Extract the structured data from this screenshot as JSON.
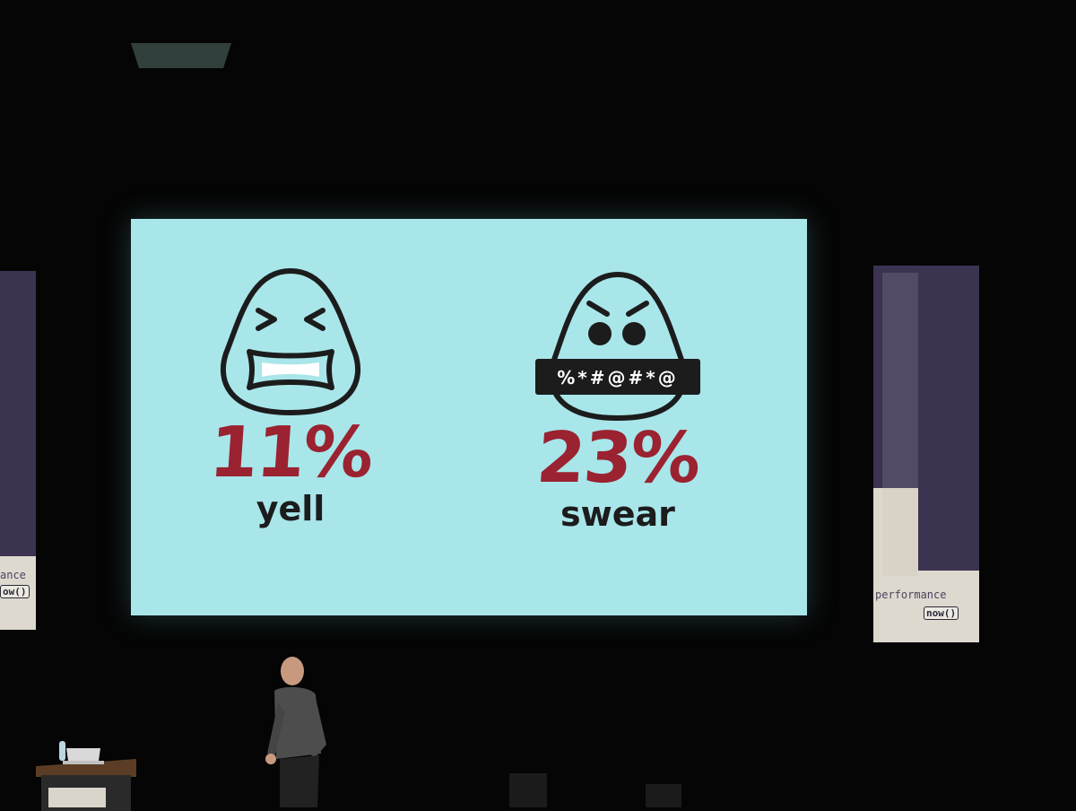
{
  "slide": {
    "stats": [
      {
        "value": "11%",
        "label": "yell"
      },
      {
        "value": "23%",
        "label": "swear"
      }
    ],
    "censor_text": "%*#@#*@"
  },
  "banners": {
    "brand_word": "performance",
    "brand_now": "now()",
    "left_brand_word": "ance",
    "left_brand_now": "ow()"
  },
  "colors": {
    "screen": "#a8e6ea",
    "percent": "#9b2230",
    "ink": "#1c1c1c",
    "banner": "#3b3350",
    "background": "#050505"
  }
}
